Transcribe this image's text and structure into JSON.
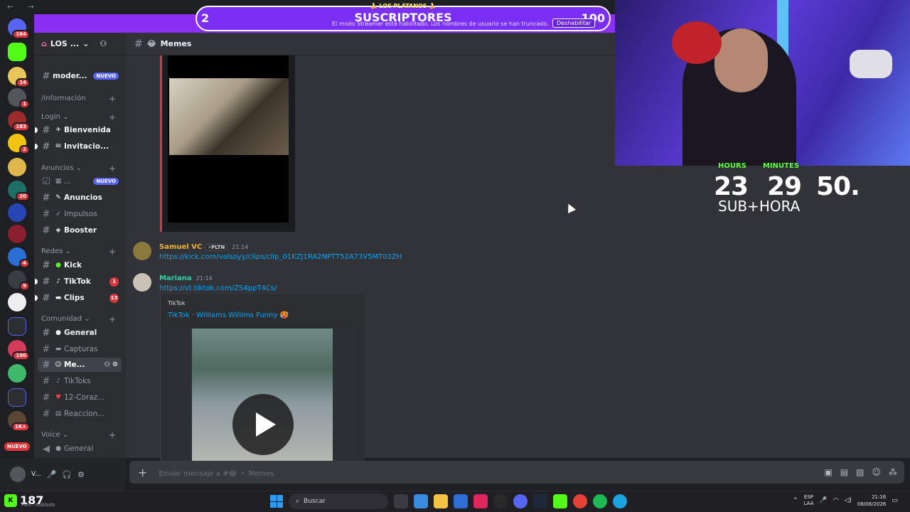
{
  "server": {
    "name": "LOS ..."
  },
  "channel": {
    "name": "Memes"
  },
  "categories": {
    "informacao": "/información",
    "login": "Login",
    "anuncios": "Anuncios",
    "redes": "Redes",
    "comunidad": "Comunidad",
    "voice": "Voice"
  },
  "channels": {
    "moder": "moder...",
    "moder_pill": "NUEVO",
    "bienvenida": "Bienvenida",
    "invitacio": "Invitacio...",
    "anuncios_new": "...",
    "anuncios_new_pill": "NUEVO",
    "anuncios": "Anuncios",
    "impulsos": "Impulsos",
    "booster": "Booster",
    "kick": "Kick",
    "tiktok": "TikTok",
    "tiktok_count": "1",
    "clips": "Clips",
    "clips_count": "13",
    "general": "General",
    "capturas": "Capturas",
    "memes": "Me...",
    "tiktoks": "TikToks",
    "corazones": "12-Coraz...",
    "reacciones": "Reaccion...",
    "voice_general": "General"
  },
  "guild_badges": [
    "164",
    "14",
    "1",
    "183",
    "2",
    "20",
    "4",
    "9",
    "100",
    "1K+"
  ],
  "guild_new": "NUEVO",
  "user": {
    "name": "V..."
  },
  "messages": [
    {
      "author": "Samuel VC",
      "tag": "⚡PLTN",
      "time": "21:14",
      "link": "https://kick.com/valsoyy/clips/clip_01KZJ1RA2NPTT52A73V5MT03ZH"
    },
    {
      "author": "Mariana",
      "time": "21:14",
      "link": "https://vt.tiktok.com/ZS4ppT4Cs/",
      "embed_provider": "TikTok",
      "embed_title": "TikTok · Williams Willims Funny 🥵"
    }
  ],
  "input": {
    "placeholder": "Enviar mensaje a #😂 ・ Memes"
  },
  "overlay": {
    "left_num": "2",
    "right_num": "100",
    "title": "SUSCRIPTORES",
    "subtitle": "🍌 LOS PLÁTANOS 🍌",
    "notice": "El modo Streamer está habilitado. Los nombres de usuario se han truncado.",
    "disable": "Deshabilitar"
  },
  "timer": {
    "hours_label": "HOURS",
    "minutes_label": "MINUTES",
    "hours": "23",
    "minutes": "29",
    "seconds": "50.",
    "sub": "SUB+HORA"
  },
  "taskbar": {
    "kick_count": "187",
    "kick_sub": "Parc. nublado",
    "search": "Buscar",
    "lang1": "ESP",
    "lang2": "LAA",
    "time": "21:16",
    "date": "08/08/2026"
  }
}
